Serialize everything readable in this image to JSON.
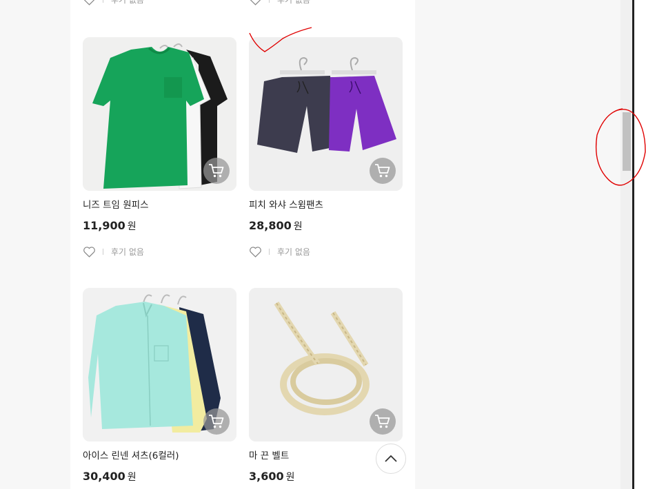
{
  "colors": {
    "page_bg": "#f7f7f7",
    "panel_bg": "#ffffff",
    "annotation": "#e00000",
    "cart_badge": "#969696"
  },
  "top_partial": [
    {
      "review_text": "후기 없음"
    },
    {
      "review_text": "후기 없음"
    }
  ],
  "products": [
    {
      "name": "니즈 트임 원피스",
      "price": "11,900",
      "currency": "원",
      "review_text": "후기 없음",
      "image": "green-tshirt-dress"
    },
    {
      "name": "피치 와샤 스윔팬츠",
      "price": "28,800",
      "currency": "원",
      "review_text": "후기 없음",
      "image": "swim-shorts"
    },
    {
      "name": "아이스 린넨 셔츠(6컬러)",
      "price": "30,400",
      "currency": "원",
      "review_text": "",
      "image": "linen-shirts"
    },
    {
      "name": "마 끈 벨트",
      "price": "3,600",
      "currency": "원",
      "review_text": "",
      "image": "rope-belt"
    }
  ],
  "icons": {
    "cart": "cart-icon",
    "heart": "heart-icon",
    "scroll_top": "chevron-up-icon"
  }
}
